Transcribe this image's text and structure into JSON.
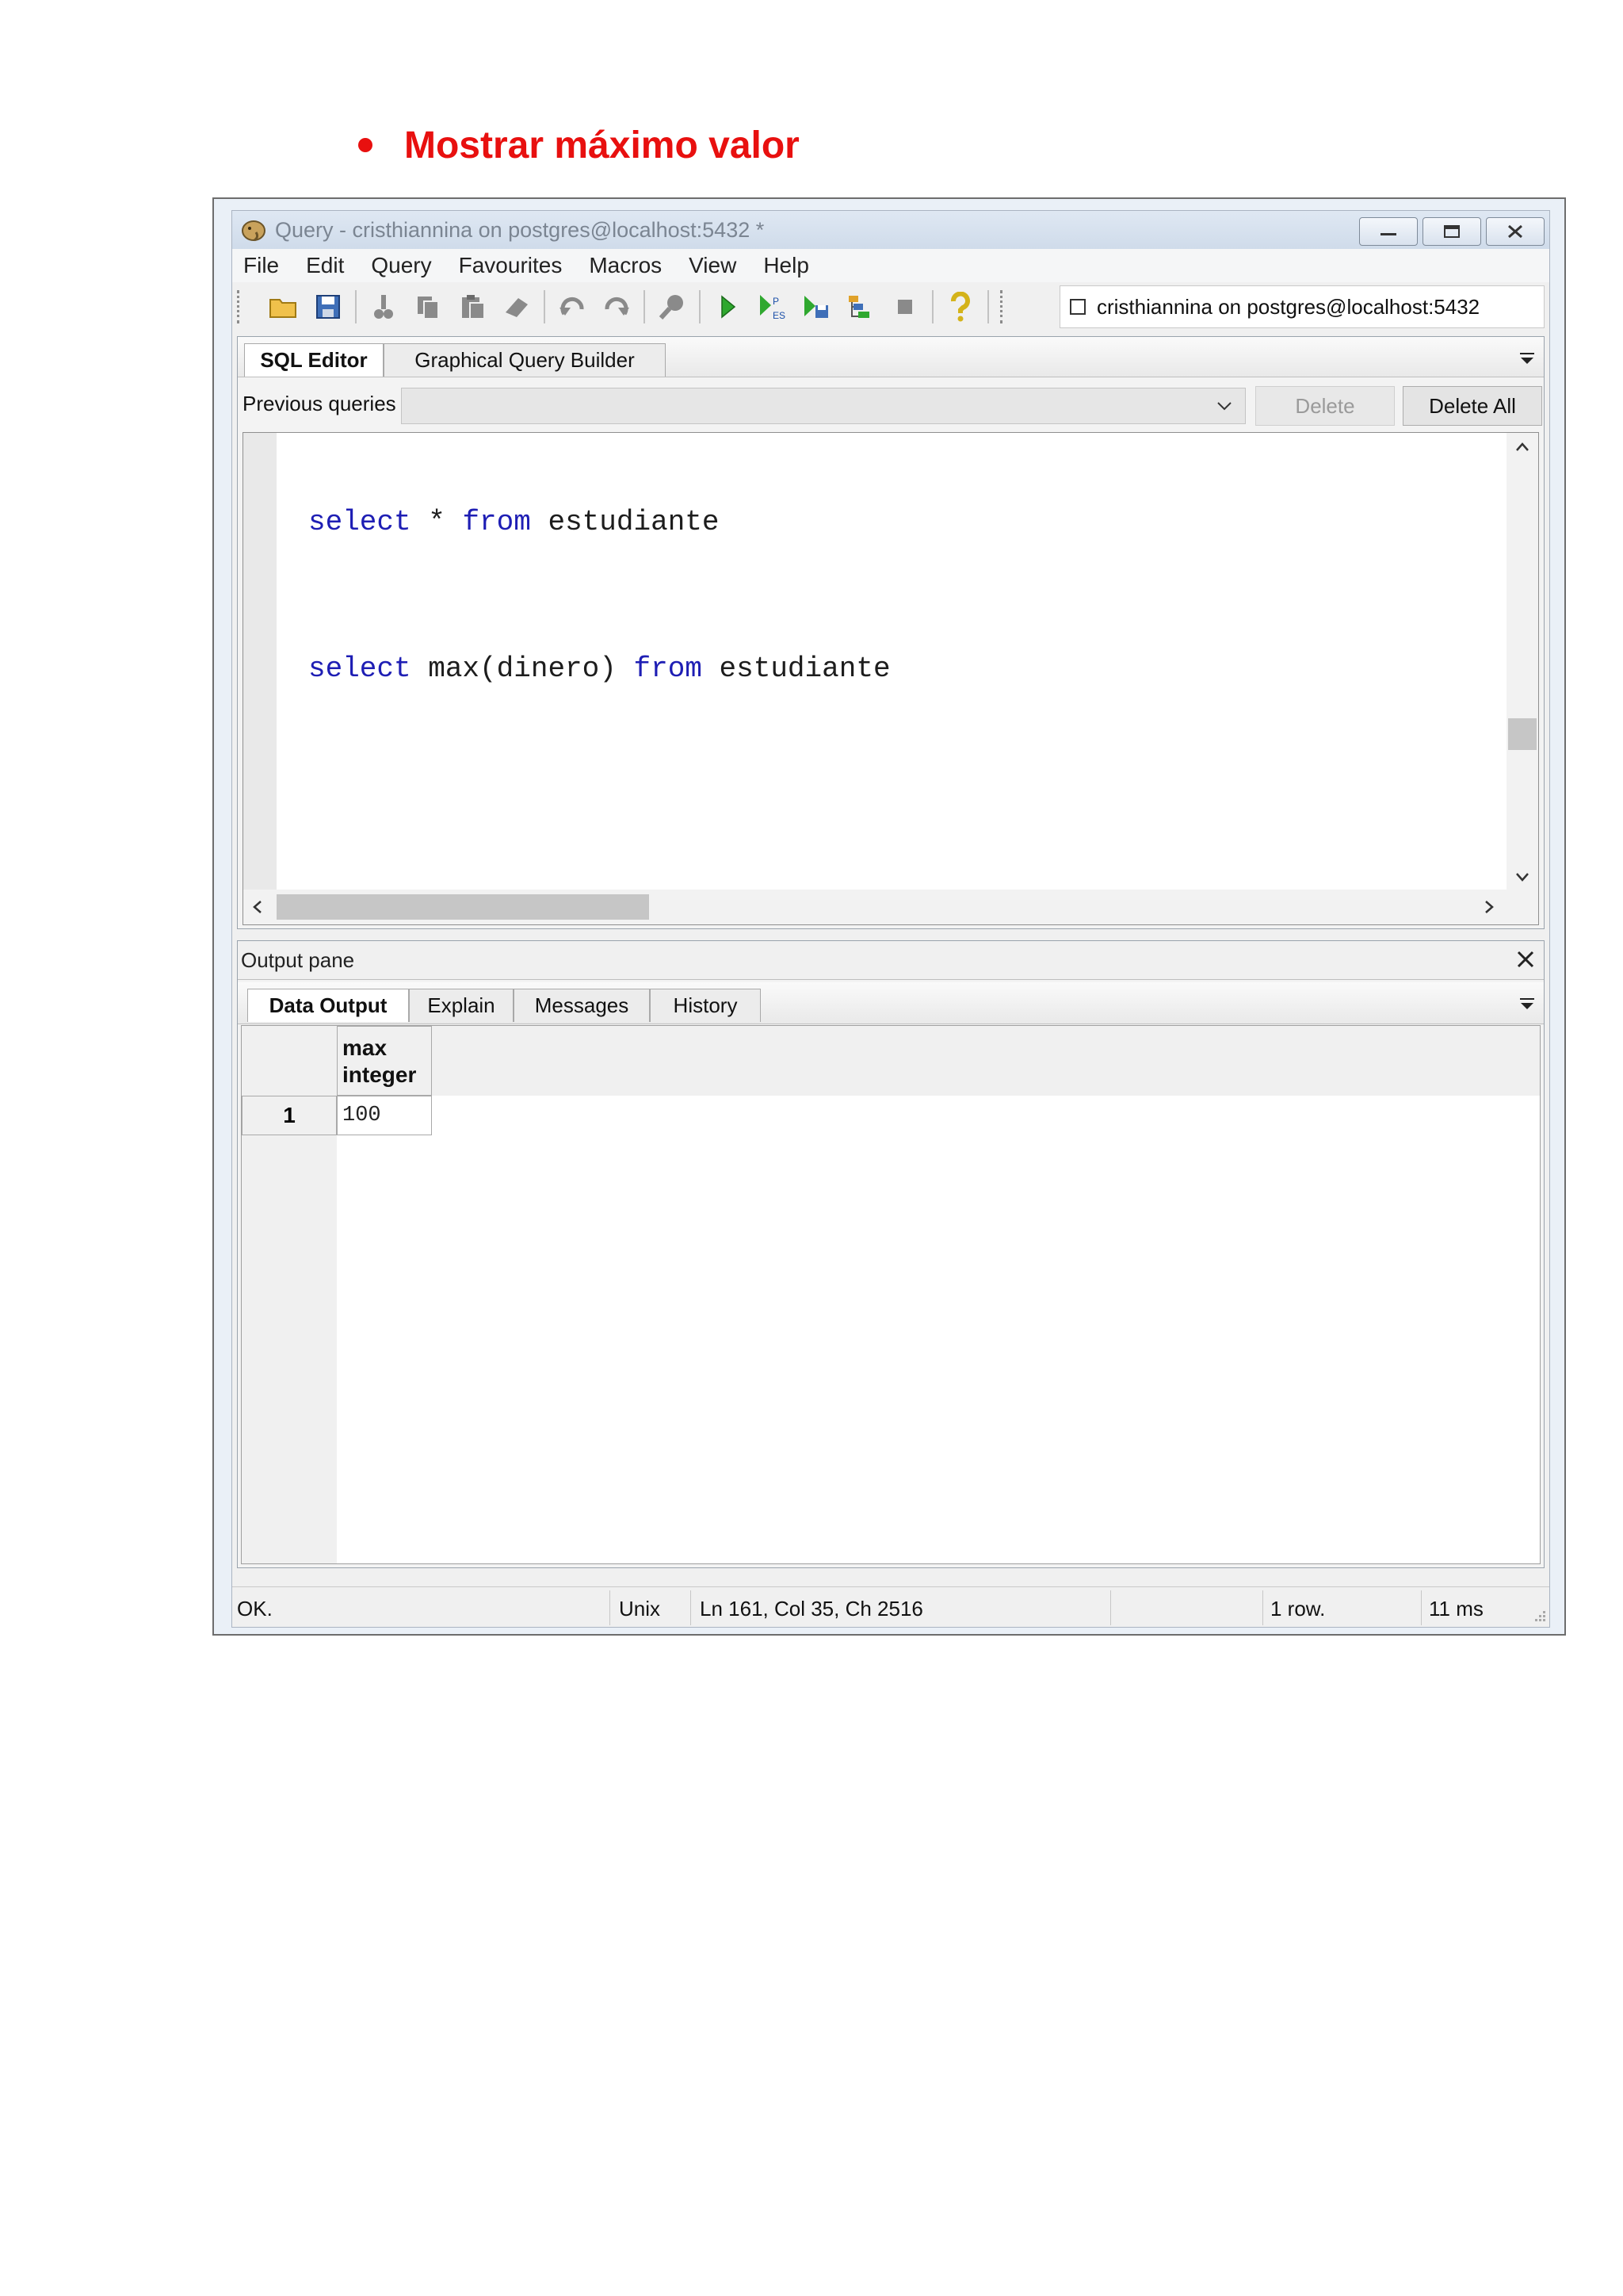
{
  "heading": {
    "text": "Mostrar  máximo valor",
    "color": "#e8100f"
  },
  "window": {
    "title": "Query - cristhiannina on postgres@localhost:5432 *",
    "controls": [
      "minimize",
      "restore",
      "close"
    ]
  },
  "menu": [
    "File",
    "Edit",
    "Query",
    "Favourites",
    "Macros",
    "View",
    "Help"
  ],
  "toolbar": {
    "icons": [
      "open-file-icon",
      "save-icon",
      "cut-icon",
      "copy-icon",
      "paste-icon",
      "clear-icon",
      "undo-icon",
      "redo-icon",
      "find-icon",
      "execute-icon",
      "explain-icon",
      "execute-to-file-icon",
      "explain-options-icon",
      "stop-icon",
      "help-icon"
    ],
    "connection": "cristhiannina on postgres@localhost:5432"
  },
  "editor": {
    "tabs": [
      "SQL Editor",
      "Graphical Query Builder"
    ],
    "previous_queries_label": "Previous queries",
    "previous_queries_value": "",
    "delete_label": "Delete",
    "delete_all_label": "Delete All",
    "lines": [
      {
        "kw1": "select",
        "mid": " * ",
        "kw2": "from",
        "rest": " estudiante"
      },
      {
        "kw1": "select",
        "mid": " max(dinero) ",
        "kw2": "from",
        "rest": " estudiante"
      }
    ]
  },
  "output": {
    "title": "Output pane",
    "tabs": [
      "Data Output",
      "Explain",
      "Messages",
      "History"
    ],
    "columns": [
      {
        "name": "max",
        "type": "integer"
      }
    ],
    "rows": [
      {
        "num": "1",
        "values": [
          "100"
        ]
      }
    ]
  },
  "status": {
    "message": "OK.",
    "line_endings": "Unix",
    "position": "Ln 161, Col 35, Ch 2516",
    "rows": "1 row.",
    "time": "11 ms"
  }
}
